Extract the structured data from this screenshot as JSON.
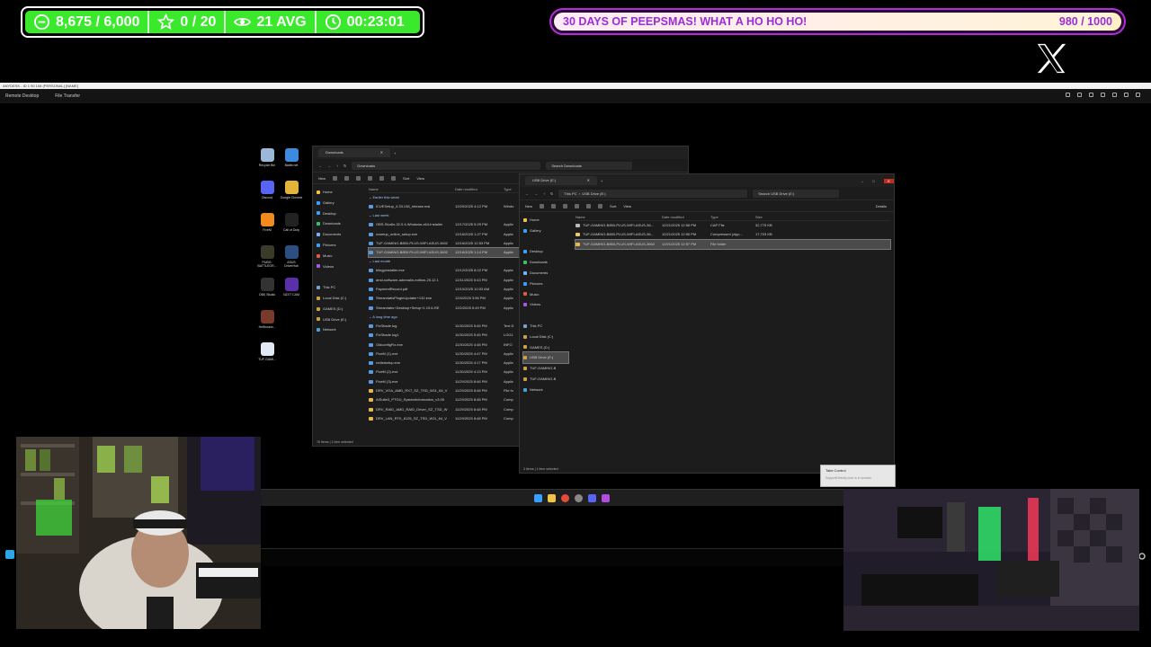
{
  "overlay": {
    "stats": {
      "points": "8,675 / 6,000",
      "favorites": "0 / 20",
      "viewers": "21 AVG",
      "timer": "00:23:01"
    },
    "event": {
      "title": "30 DAYS OF PEEPSMAS! WHAT A HO HO HO!",
      "progress_text": "980 / 1000",
      "progress_fraction": 0.98
    },
    "colors": {
      "stats_green": "#3be92c",
      "event_purple": "#9b2dd6"
    }
  },
  "remote_desktop": {
    "title": "ANYDESK - ID 1 90 108 (PERSONAL) [NAME]",
    "menu_remote": "Remote Desktop",
    "menu_transfer": "File Transfer"
  },
  "desktop_icons": [
    {
      "label": "Recycle Bin",
      "icon": "recycle-bin-icon"
    },
    {
      "label": "Battle.net",
      "icon": "battlenet-icon"
    },
    {
      "label": "Discord",
      "icon": "discord-icon"
    },
    {
      "label": "Google Chrome",
      "icon": "chrome-icon"
    },
    {
      "label": "FiveM",
      "icon": "fivem-icon"
    },
    {
      "label": "Call of Duty",
      "icon": "cod-icon"
    },
    {
      "label": "PUBG: BATTLEGR...",
      "icon": "pubg-icon"
    },
    {
      "label": "ASUS DriverHub",
      "icon": "asus-icon"
    },
    {
      "label": "OBS Studio",
      "icon": "obs-icon"
    },
    {
      "label": "NZXT CAM",
      "icon": "nzxt-icon"
    },
    {
      "label": "Hellbound...",
      "icon": "game-icon"
    },
    {
      "label": "TUF-GAMI...",
      "icon": "file-icon"
    }
  ],
  "downloads_window": {
    "tab": "Downloads",
    "path": "Downloads",
    "search": "Search Downloads",
    "new_label": "New",
    "sort_label": "Sort",
    "view_label": "View",
    "columns": [
      "Name",
      "Date modified",
      "Type"
    ],
    "nav": [
      "Home",
      "Gallery",
      "Desktop",
      "Downloads",
      "Documents",
      "Pictures",
      "Music",
      "Videos",
      "",
      "This PC",
      "Local Disk (C:)",
      "GAMES (D:)",
      "USB Drive (E:)",
      "Network"
    ],
    "groups": [
      {
        "title": "Earlier this week",
        "rows": [
          [
            "iCUESetup_4.33.138_release.msi",
            "12/20/2025 4:12 PM",
            "Windo"
          ]
        ]
      },
      {
        "title": "Last week",
        "rows": [
          [
            "OBS-Studio-32.0.4-Windows-x64-Installer",
            "12/17/2025 5:29 PM",
            "Applic"
          ],
          [
            "ccsetup_online_setup.exe",
            "12/16/2025 1:27 PM",
            "Applic"
          ],
          [
            "TUF-GAMING-B850-PLUS-WIFI-ASUS-3602",
            "12/16/2025 12:53 PM",
            "Applic"
          ],
          [
            "TUF-GAMING-B850-PLUS-WIFI-ASUS-3602",
            "12/16/2025 1:14 PM",
            "Applic"
          ]
        ]
      },
      {
        "title": "Last month",
        "rows": [
          [
            "blingpinstaller.exe",
            "12/12/2025 8:22 PM",
            "Applic"
          ],
          [
            "amd-software-adrenalin-edition-25.12.1",
            "12/11/2025 5:43 PM",
            "Applic"
          ],
          [
            "PaymentRecord.pdf",
            "12/10/2025 10:03 AM",
            "Applic"
          ],
          [
            "StreamlabsPluginUpdater+132.exe",
            "12/4/2025 3:56 PM",
            "Applic"
          ],
          [
            "Streamlabs+Desktop+Setup+1.19.6-RE",
            "12/2/2025 5:49 PM",
            "Applic"
          ]
        ]
      },
      {
        "title": "A long time ago",
        "rows": [
          [
            "FixShade.log",
            "11/30/2025 5:45 PM",
            "Text D"
          ],
          [
            "FixShade.log1",
            "11/30/2025 5:45 PM",
            "LOG1"
          ],
          [
            "OldconfigFix.exe",
            "11/30/2025 4:48 PM",
            "INFO"
          ],
          [
            "FiveM (1).exe",
            "11/30/2025 4:47 PM",
            "Applic"
          ],
          [
            "redistsetup.exe",
            "11/30/2025 4:17 PM",
            "Applic"
          ],
          [
            "FiveM (2).exe",
            "11/30/2025 4:13 PM",
            "Applic"
          ],
          [
            "FiveM (3).exe",
            "11/29/2025 8:46 PM",
            "Applic"
          ],
          [
            "DRV_VGA_AMD_RX7_SZ_TSD_W11_64_V",
            "11/29/2025 8:48 PM",
            "File fo"
          ],
          [
            "AISuite3_PTGU_SystemInformation_v3.05",
            "11/29/2025 8:48 PM",
            "Comp"
          ],
          [
            "DRV_RAID_AMD_RAID_Driver_SZ_TSD_W",
            "11/29/2025 8:48 PM",
            "Comp"
          ],
          [
            "DRV_LAN_RTK_8125_SZ_TSD_W11_64_V",
            "11/29/2025 8:48 PM",
            "Comp"
          ]
        ]
      }
    ],
    "status": "76 items  |  1 item selected"
  },
  "usb_window": {
    "tab": "USB Drive (E:)",
    "path_1": "This PC",
    "path_2": "USB Drive (E:)",
    "search": "Search USB Drive (E:)",
    "new_label": "New",
    "sort_label": "Sort",
    "view_label": "View",
    "details_label": "Details",
    "columns": [
      "Name",
      "Date modified",
      "Type",
      "Size"
    ],
    "nav": [
      "Home",
      "Gallery",
      "",
      "Desktop",
      "Downloads",
      "Documents",
      "Pictures",
      "Music",
      "Videos",
      "",
      "This PC",
      "Local Disk (C:)",
      "GAMES (D:)",
      "USB Drive (E:)",
      "TUF-GAMING-B",
      "TUF-GAMING-B",
      "Network"
    ],
    "rows": [
      [
        "TUF-GAMING-B850-PLUS-WIFI-ASUS-36...",
        "12/21/2025 12:58 PM",
        "CAP File",
        "32,775 KB"
      ],
      [
        "TUF-GAMING-B850-PLUS-WIFI-ASUS-36...",
        "12/21/2025 12:55 PM",
        "Compressed (zipp...",
        "17,703 KB"
      ],
      [
        "TUF-GAMING-B850-PLUS-WIFI-ASUS-3602",
        "12/21/2025 12:57 PM",
        "File folder",
        ""
      ]
    ],
    "status": "3 items  |  1 item selected"
  },
  "toast": {
    "title": "Take Control",
    "body": "SupportDirectly.com is in session"
  }
}
